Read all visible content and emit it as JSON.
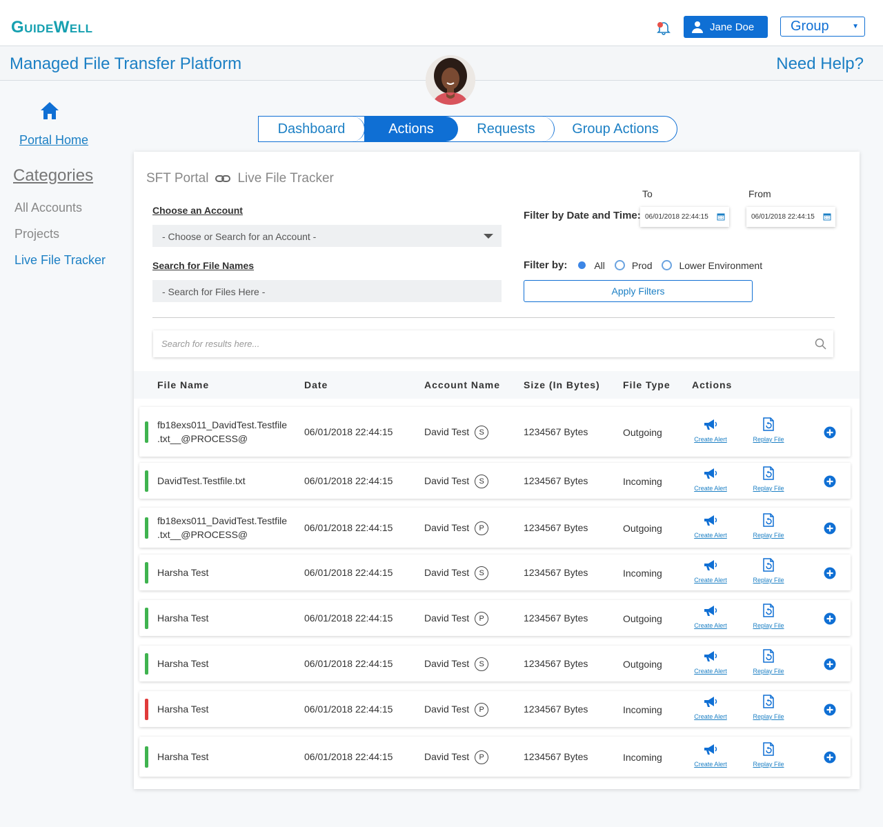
{
  "header": {
    "logo": "GuideWell",
    "user_name": "Jane Doe",
    "group_select": "Group"
  },
  "titlebar": {
    "title": "Managed File Transfer Platform",
    "help": "Need Help?"
  },
  "sidebar": {
    "home_label": "Portal Home",
    "categories_label": "Categories",
    "items": [
      {
        "label": "All Accounts",
        "active": false
      },
      {
        "label": "Projects",
        "active": false
      },
      {
        "label": "Live File Tracker",
        "active": true
      }
    ]
  },
  "tabs": [
    {
      "label": "Dashboard",
      "active": false
    },
    {
      "label": "Actions",
      "active": true
    },
    {
      "label": "Requests",
      "active": false
    },
    {
      "label": "Group Actions",
      "active": false
    }
  ],
  "breadcrumb": {
    "root": "SFT Portal",
    "current": "Live File Tracker"
  },
  "filters": {
    "account_label": "Choose an Account",
    "account_placeholder": "- Choose or Search for an Account -",
    "file_label": "Search for File Names",
    "file_placeholder": "- Search for Files Here -",
    "date_label": "Filter by Date and Time:",
    "to_label": "To",
    "from_label": "From",
    "to_value": "06/01/2018 22:44:15",
    "from_value": "06/01/2018 22:44:15",
    "filter_by_label": "Filter by:",
    "radio_options": [
      "All",
      "Prod",
      "Lower Environment"
    ],
    "radio_selected": "All",
    "apply_label": "Apply Filters"
  },
  "results_search_placeholder": "Search for results here...",
  "table": {
    "columns": [
      "File Name",
      "Date",
      "Account Name",
      "Size (In Bytes)",
      "File Type",
      "Actions"
    ],
    "action_labels": {
      "alert": "Create Alert",
      "replay": "Replay File"
    },
    "rows": [
      {
        "file_line1": "fb18exs011_DavidTest.Testfile",
        "file_line2": ".txt__@PROCESS@",
        "date": "06/01/2018 22:44:15",
        "account": "David Test",
        "badge": "S",
        "size": "1234567 Bytes",
        "type": "Outgoing",
        "status": "success"
      },
      {
        "file_line1": "DavidTest.Testfile.txt",
        "file_line2": "",
        "date": "06/01/2018 22:44:15",
        "account": "David Test",
        "badge": "S",
        "size": "1234567 Bytes",
        "type": "Incoming",
        "status": "success"
      },
      {
        "file_line1": "fb18exs011_DavidTest.Testfile",
        "file_line2": ".txt__@PROCESS@",
        "date": "06/01/2018 22:44:15",
        "account": "David Test",
        "badge": "P",
        "size": "1234567 Bytes",
        "type": "Outgoing",
        "status": "success"
      },
      {
        "file_line1": "Harsha Test",
        "file_line2": "",
        "date": "06/01/2018 22:44:15",
        "account": "David Test",
        "badge": "S",
        "size": "1234567 Bytes",
        "type": "Incoming",
        "status": "success"
      },
      {
        "file_line1": "Harsha Test",
        "file_line2": "",
        "date": "06/01/2018 22:44:15",
        "account": "David Test",
        "badge": "P",
        "size": "1234567 Bytes",
        "type": "Outgoing",
        "status": "success"
      },
      {
        "file_line1": "Harsha Test",
        "file_line2": "",
        "date": "06/01/2018 22:44:15",
        "account": "David Test",
        "badge": "S",
        "size": "1234567 Bytes",
        "type": "Outgoing",
        "status": "success"
      },
      {
        "file_line1": "Harsha Test",
        "file_line2": "",
        "date": "06/01/2018 22:44:15",
        "account": "David Test",
        "badge": "P",
        "size": "1234567 Bytes",
        "type": "Incoming",
        "status": "error"
      },
      {
        "file_line1": "Harsha Test",
        "file_line2": "",
        "date": "06/01/2018 22:44:15",
        "account": "David Test",
        "badge": "P",
        "size": "1234567 Bytes",
        "type": "Incoming",
        "status": "success"
      }
    ]
  },
  "colors": {
    "brand": "#16a0b0",
    "primary": "#0f6fd4",
    "link": "#1b7fc4",
    "status_success": "#3fb34f",
    "status_error": "#e03a3a"
  },
  "icons": {
    "notification": "bell-icon",
    "user": "user-icon",
    "home": "home-icon",
    "link": "link-icon",
    "calendar": "calendar-icon",
    "search": "search-icon",
    "alert": "megaphone-icon",
    "replay": "replay-file-icon",
    "expand": "plus-circle-icon"
  }
}
